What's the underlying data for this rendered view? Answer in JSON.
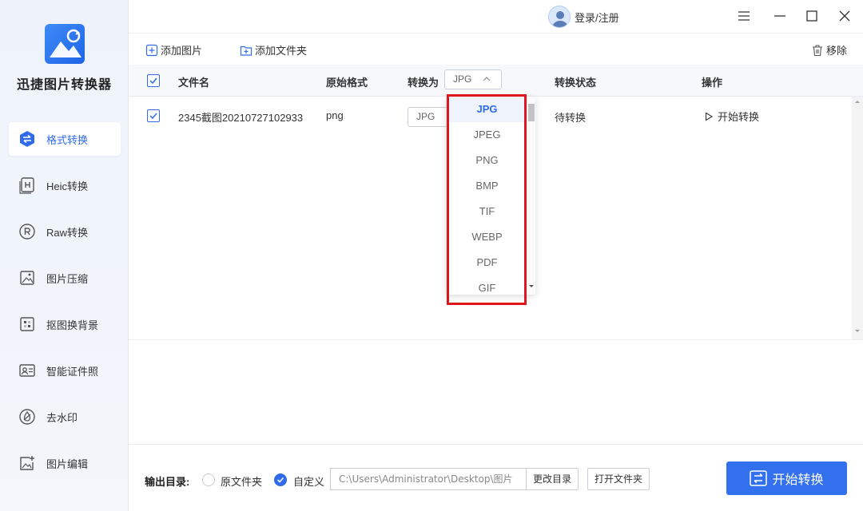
{
  "app": {
    "name": "迅捷图片转换器"
  },
  "sidebar": {
    "items": [
      {
        "label": "格式转换",
        "icon": "swap-icon"
      },
      {
        "label": "Heic转换",
        "icon": "heic-icon"
      },
      {
        "label": "Raw转换",
        "icon": "raw-icon"
      },
      {
        "label": "图片压缩",
        "icon": "compress-icon"
      },
      {
        "label": "抠图换背景",
        "icon": "cutout-icon"
      },
      {
        "label": "智能证件照",
        "icon": "id-photo-icon"
      },
      {
        "label": "去水印",
        "icon": "watermark-icon"
      },
      {
        "label": "图片编辑",
        "icon": "image-edit-icon"
      }
    ]
  },
  "header": {
    "user_label": "登录/注册"
  },
  "toolbar": {
    "add_image": "添加图片",
    "add_folder": "添加文件夹",
    "remove": "移除"
  },
  "table": {
    "headers": {
      "filename": "文件名",
      "format": "原始格式",
      "convert_to": "转换为",
      "status": "转换状态",
      "action": "操作"
    },
    "header_select_value": "JPG",
    "rows": [
      {
        "filename": "2345截图20210727102933",
        "format": "png",
        "target": "JPG",
        "status": "待转换",
        "action": "开始转换"
      }
    ]
  },
  "dropdown": {
    "options": [
      "JPG",
      "JPEG",
      "PNG",
      "BMP",
      "TIF",
      "WEBP",
      "PDF",
      "GIF"
    ],
    "selected": "JPG"
  },
  "footer": {
    "output_label": "输出目录:",
    "option_original": "原文件夹",
    "option_custom": "自定义",
    "path": "C:\\Users\\Administrator\\Desktop\\图片",
    "change_dir": "更改目录",
    "open_folder": "打开文件夹",
    "start_button": "开始转换"
  },
  "colors": {
    "accent": "#3370ee",
    "highlight": "#e0161e"
  }
}
